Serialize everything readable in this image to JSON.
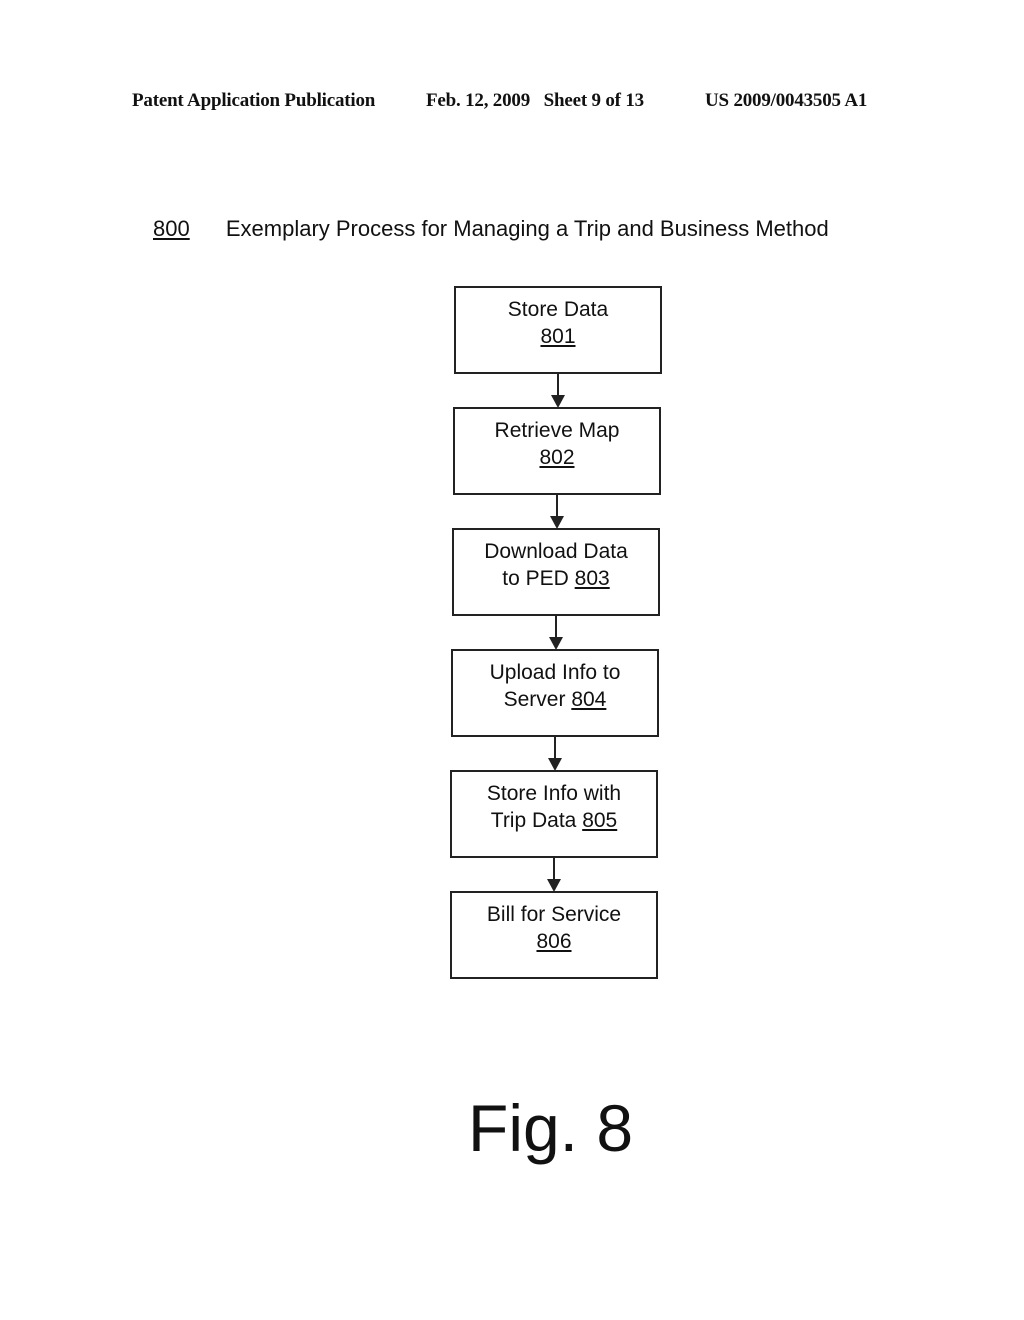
{
  "header": {
    "left": "Patent Application Publication",
    "middle": "Feb. 12, 2009   Sheet 9 of 13",
    "right": "US 2009/0043505 A1"
  },
  "diagram": {
    "ref": "800",
    "title": "Exemplary Process for Managing a Trip and Business Method",
    "steps": [
      {
        "line1": "Store Data",
        "line2": "",
        "ref": "801"
      },
      {
        "line1": "Retrieve Map",
        "line2": "",
        "ref": "802"
      },
      {
        "line1": "Download Data",
        "line2": "to PED ",
        "ref": "803"
      },
      {
        "line1": "Upload Info to",
        "line2": "Server ",
        "ref": "804"
      },
      {
        "line1": "Store Info with",
        "line2": "Trip Data ",
        "ref": "805"
      },
      {
        "line1": "Bill for Service",
        "line2": "",
        "ref": "806"
      }
    ],
    "edges": [
      {
        "from": "801",
        "to": "802"
      },
      {
        "from": "802",
        "to": "803"
      },
      {
        "from": "803",
        "to": "804"
      },
      {
        "from": "804",
        "to": "805"
      },
      {
        "from": "805",
        "to": "806"
      }
    ]
  },
  "figure_label": "Fig. 8"
}
